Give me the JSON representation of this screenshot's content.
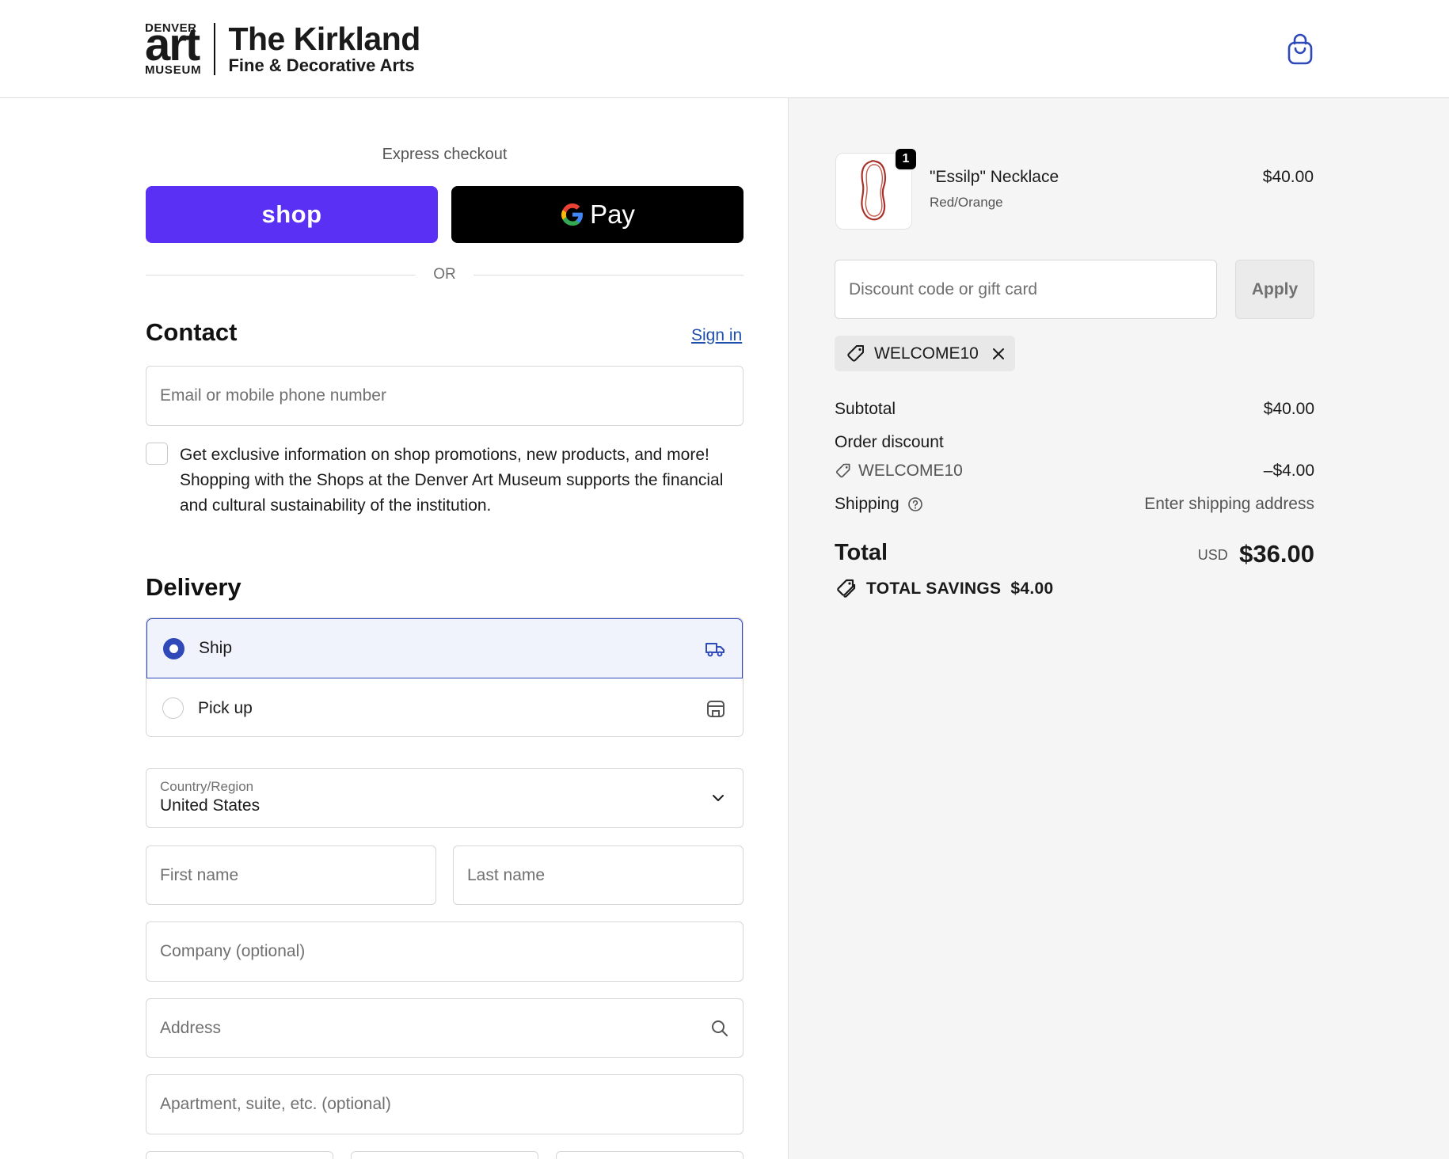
{
  "header": {
    "logo": {
      "denver": "DENVER",
      "art": "art",
      "museum": "MUSEUM",
      "store_name": "The Kirkland",
      "store_subtitle": "Fine & Decorative Arts"
    },
    "cart_icon": "shopping-bag-icon"
  },
  "express": {
    "label": "Express checkout",
    "shop_label": "shop",
    "gpay_label": "Pay",
    "or_label": "OR"
  },
  "contact": {
    "title": "Contact",
    "sign_in": "Sign in",
    "email_placeholder": "Email or mobile phone number",
    "promo_text": "Get exclusive information on shop promotions, new products, and more! Shopping with the Shops at the Denver Art Museum supports the financial and cultural sustainability of the institution.",
    "promo_checked": false
  },
  "delivery": {
    "title": "Delivery",
    "options": [
      {
        "label": "Ship",
        "selected": true,
        "icon": "truck-icon"
      },
      {
        "label": "Pick up",
        "selected": false,
        "icon": "store-icon"
      }
    ],
    "country_label": "Country/Region",
    "country_value": "United States",
    "first_name_placeholder": "First name",
    "last_name_placeholder": "Last name",
    "company_placeholder": "Company (optional)",
    "address_placeholder": "Address",
    "apartment_placeholder": "Apartment, suite, etc. (optional)"
  },
  "summary": {
    "item": {
      "name": "\"Essilp\" Necklace",
      "variant": "Red/Orange",
      "price": "$40.00",
      "quantity": "1"
    },
    "discount_placeholder": "Discount code or gift card",
    "apply_label": "Apply",
    "applied_code": "WELCOME10",
    "subtotal_label": "Subtotal",
    "subtotal_value": "$40.00",
    "order_discount_label": "Order discount",
    "discount_code": "WELCOME10",
    "discount_value": "–$4.00",
    "shipping_label": "Shipping",
    "shipping_value": "Enter shipping address",
    "total_label": "Total",
    "total_currency": "USD",
    "total_value": "$36.00",
    "savings_label": "TOTAL SAVINGS",
    "savings_value": "$4.00"
  },
  "colors": {
    "shop_purple": "#5a31f4",
    "accent_blue": "#2f4ab8",
    "link_blue": "#1f4fad"
  }
}
